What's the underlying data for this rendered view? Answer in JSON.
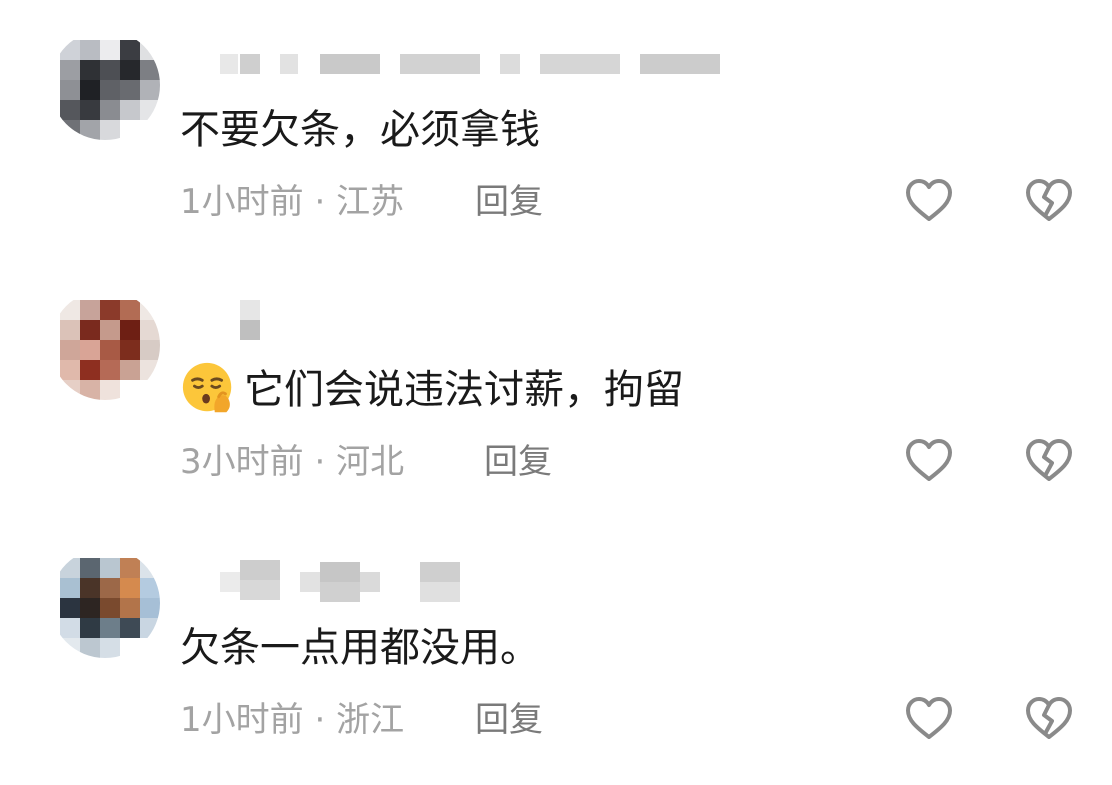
{
  "comments": [
    {
      "text": "不要欠条，必须拿钱",
      "time": "1小时前",
      "separator": " · ",
      "location": "江苏",
      "reply_label": "回复",
      "icons": {
        "like": "heart-outline-icon",
        "dislike": "broken-heart-outline-icon"
      }
    },
    {
      "emoji": "shushing-face-emoji",
      "text": "它们会说违法讨薪，拘留",
      "time": "3小时前",
      "separator": " · ",
      "location": "河北",
      "reply_label": "回复",
      "icons": {
        "like": "heart-outline-icon",
        "dislike": "broken-heart-outline-icon"
      }
    },
    {
      "text": "欠条一点用都没用。",
      "time": "1小时前",
      "separator": " · ",
      "location": "浙江",
      "reply_label": "回复",
      "icons": {
        "like": "heart-outline-icon",
        "dislike": "broken-heart-outline-icon"
      }
    }
  ],
  "colors": {
    "text": "#1a1a1a",
    "meta": "#a3a3a3",
    "reply": "#7a7a7a",
    "icon": "#8a8a8a"
  }
}
